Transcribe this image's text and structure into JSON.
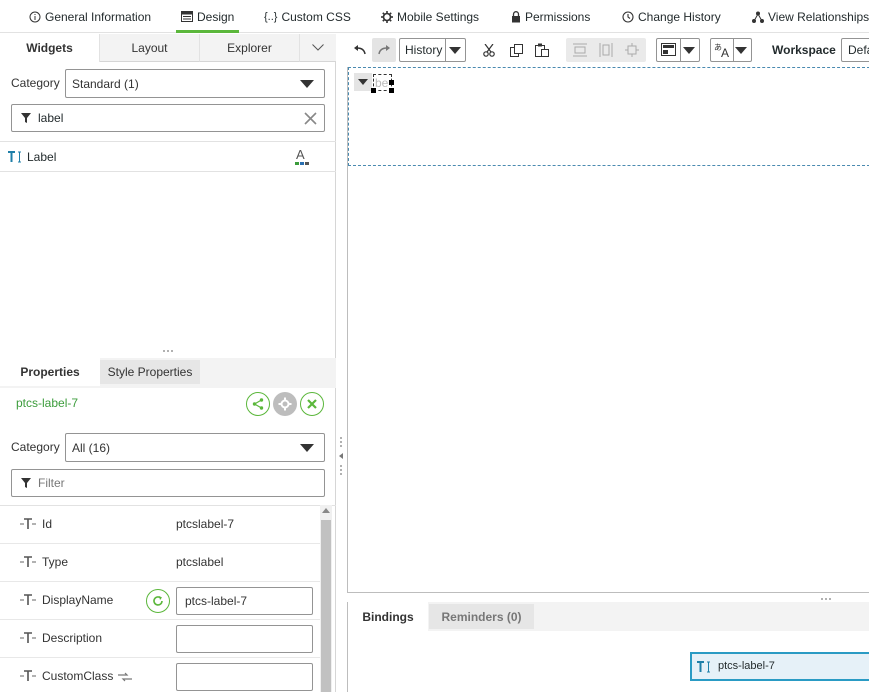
{
  "top_tabs": [
    {
      "label": "General Information",
      "icon": "info-icon"
    },
    {
      "label": "Design",
      "icon": "design-icon"
    },
    {
      "label": "Custom CSS",
      "icon": "css-icon"
    },
    {
      "label": "Mobile Settings",
      "icon": "gear-icon"
    },
    {
      "label": "Permissions",
      "icon": "lock-icon"
    },
    {
      "label": "Change History",
      "icon": "clock-icon"
    },
    {
      "label": "View Relationships",
      "icon": "relationships-icon"
    }
  ],
  "active_top_tab": "Design",
  "accent_color": "#5bb73b",
  "left_tabs": [
    "Widgets",
    "Layout",
    "Explorer"
  ],
  "widgets": {
    "category_label": "Category",
    "category_value": "Standard (1)",
    "search_value": "label",
    "results": [
      {
        "label": "Label"
      }
    ]
  },
  "toolbar": {
    "history_label": "History",
    "workspace_label": "Workspace",
    "workspace_value": "Defa"
  },
  "properties": {
    "tabs": [
      "Properties",
      "Style Properties"
    ],
    "widget_id": "ptcs-label-7",
    "category_label": "Category",
    "category_value": "All (16)",
    "filter_placeholder": "Filter",
    "rows": [
      {
        "name": "Id",
        "value": "ptcslabel-7"
      },
      {
        "name": "Type",
        "value": "ptcslabel"
      },
      {
        "name": "DisplayName",
        "value": "ptcs-label-7"
      },
      {
        "name": "Description",
        "value": ""
      },
      {
        "name": "CustomClass",
        "value": ""
      }
    ]
  },
  "bottom": {
    "tabs": [
      "Bindings",
      "Reminders (0)"
    ],
    "selected_widget": "ptcs-label-7"
  },
  "canvas": {
    "label_text": "be"
  }
}
